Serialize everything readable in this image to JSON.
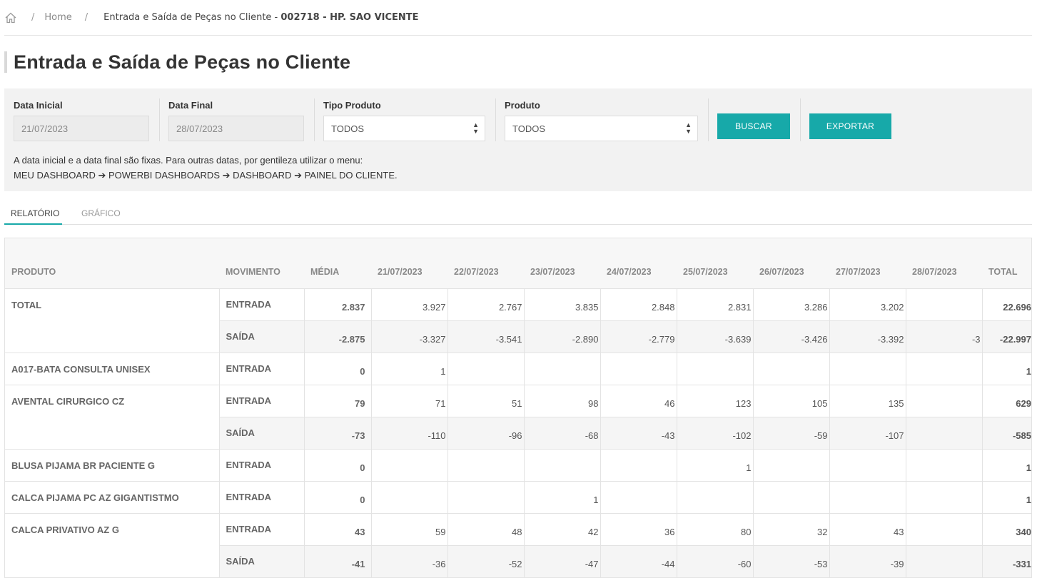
{
  "breadcrumb": {
    "home": "Home",
    "current_prefix": "Entrada e Saída de Peças no Cliente - ",
    "current_code": "002718",
    "current_sep": " - ",
    "current_client": "HP. SAO VICENTE"
  },
  "page_title": "Entrada e Saída de Peças no Cliente",
  "filters": {
    "data_inicial_label": "Data Inicial",
    "data_inicial_value": "21/07/2023",
    "data_final_label": "Data Final",
    "data_final_value": "28/07/2023",
    "tipo_produto_label": "Tipo Produto",
    "tipo_produto_value": "TODOS",
    "produto_label": "Produto",
    "produto_value": "TODOS",
    "buscar_label": "BUSCAR",
    "exportar_label": "EXPORTAR",
    "note_line1": "A data inicial e a data final são fixas. Para outras datas, por gentileza utilizar o menu:",
    "note_line2": "MEU DASHBOARD ➔ POWERBI DASHBOARDS ➔ DASHBOARD ➔ PAINEL DO CLIENTE."
  },
  "tabs": [
    "RELATÓRIO",
    "GRÁFICO"
  ],
  "table": {
    "headers": [
      "PRODUTO",
      "MOVIMENTO",
      "MÉDIA",
      "21/07/2023",
      "22/07/2023",
      "23/07/2023",
      "24/07/2023",
      "25/07/2023",
      "26/07/2023",
      "27/07/2023",
      "28/07/2023",
      "TOTAL"
    ],
    "rows": [
      {
        "produto": "TOTAL",
        "movimento": "ENTRADA",
        "media": "2.837",
        "values": [
          "3.927",
          "2.767",
          "3.835",
          "2.848",
          "2.831",
          "3.286",
          "3.202",
          ""
        ],
        "total": "22.696"
      },
      {
        "produto": "",
        "movimento": "SAÍDA",
        "media": "-2.875",
        "values": [
          "-3.327",
          "-3.541",
          "-2.890",
          "-2.779",
          "-3.639",
          "-3.426",
          "-3.392",
          "-3"
        ],
        "total": "-22.997"
      },
      {
        "produto": "A017-BATA CONSULTA UNISEX",
        "movimento": "ENTRADA",
        "media": "0",
        "values": [
          "1",
          "",
          "",
          "",
          "",
          "",
          "",
          ""
        ],
        "total": "1"
      },
      {
        "produto": "AVENTAL CIRURGICO CZ",
        "movimento": "ENTRADA",
        "media": "79",
        "values": [
          "71",
          "51",
          "98",
          "46",
          "123",
          "105",
          "135",
          ""
        ],
        "total": "629"
      },
      {
        "produto": "",
        "movimento": "SAÍDA",
        "media": "-73",
        "values": [
          "-110",
          "-96",
          "-68",
          "-43",
          "-102",
          "-59",
          "-107",
          ""
        ],
        "total": "-585"
      },
      {
        "produto": "BLUSA PIJAMA BR PACIENTE G",
        "movimento": "ENTRADA",
        "media": "0",
        "values": [
          "",
          "",
          "",
          "",
          "1",
          "",
          "",
          ""
        ],
        "total": "1"
      },
      {
        "produto": "CALCA PIJAMA PC AZ GIGANTISTMO",
        "movimento": "ENTRADA",
        "media": "0",
        "values": [
          "",
          "",
          "1",
          "",
          "",
          "",
          "",
          ""
        ],
        "total": "1"
      },
      {
        "produto": "CALCA PRIVATIVO AZ G",
        "movimento": "ENTRADA",
        "media": "43",
        "values": [
          "59",
          "48",
          "42",
          "36",
          "80",
          "32",
          "43",
          ""
        ],
        "total": "340"
      },
      {
        "produto": "",
        "movimento": "SAÍDA",
        "media": "-41",
        "values": [
          "-36",
          "-52",
          "-47",
          "-44",
          "-60",
          "-53",
          "-39",
          ""
        ],
        "total": "-331"
      }
    ]
  }
}
